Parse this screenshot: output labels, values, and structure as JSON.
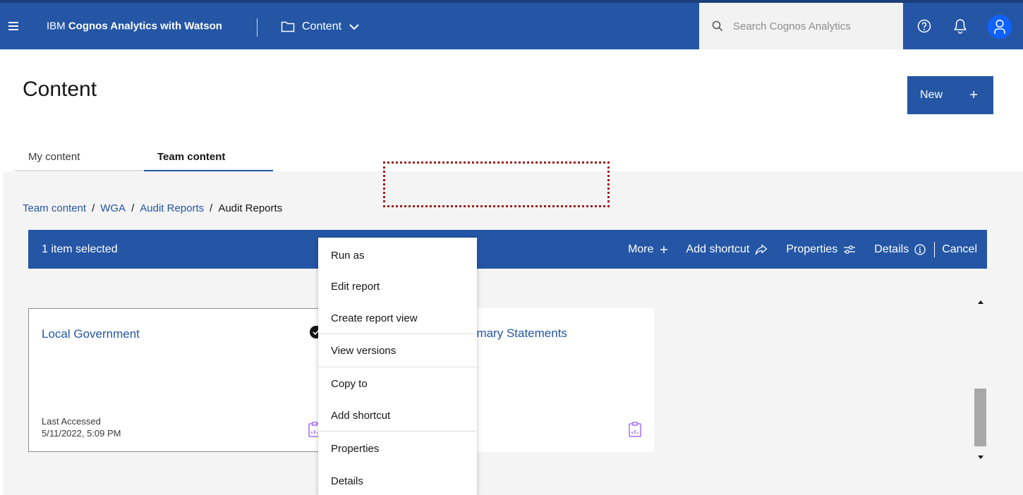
{
  "header": {
    "app_title_prefix": "IBM ",
    "app_title_bold": "Cognos Analytics with Watson",
    "content_switcher_label": "Content",
    "search_placeholder": "Search Cognos Analytics"
  },
  "page": {
    "title": "Content",
    "new_button_label": "New",
    "new_button_plus": "+"
  },
  "tabs": [
    {
      "label": "My content",
      "active": false
    },
    {
      "label": "Team content",
      "active": true
    }
  ],
  "breadcrumb": {
    "items": [
      "Team content",
      "WGA",
      "Audit Reports"
    ],
    "current": "Audit Reports",
    "separator": "/"
  },
  "action_bar": {
    "selected_text": "1 item selected",
    "more_label": "More",
    "add_shortcut_label": "Add shortcut",
    "properties_label": "Properties",
    "details_label": "Details",
    "cancel_label": "Cancel"
  },
  "cards": [
    {
      "title": "Local Government",
      "meta_label": "Last Accessed",
      "meta_value": "5/11/2022, 5:09 PM",
      "selected": true
    },
    {
      "title": "rimary Statements",
      "meta_label": "",
      "meta_value": "",
      "selected": false
    }
  ],
  "context_menu": {
    "items": [
      "Run as",
      "Edit report",
      "Create report view",
      "View versions",
      "Copy to",
      "Add shortcut",
      "Properties",
      "Details"
    ]
  },
  "colors": {
    "brand_blue": "#2456a5",
    "avatar_blue": "#0f62fe",
    "report_icon": "#a56eff",
    "annotation_red": "#9b1c1c"
  }
}
